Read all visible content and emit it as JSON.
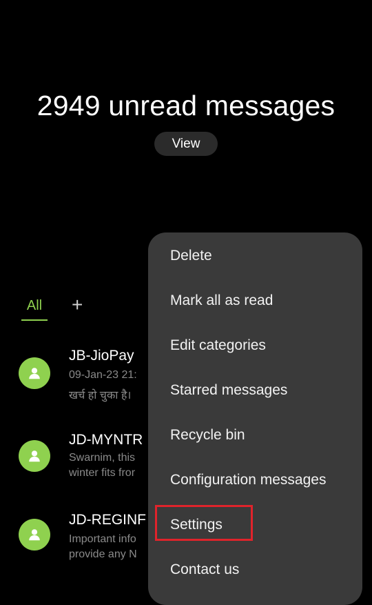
{
  "header": {
    "unread_count_text": "2949 unread messages",
    "view_button": "View"
  },
  "tabs": {
    "all_label": "All",
    "add_label": "+"
  },
  "conversations": [
    {
      "sender": "JB-JioPay",
      "line1": "09-Jan-23 21:",
      "line2": "खर्च हो चुका है। ",
      "avatar_icon": "person-icon"
    },
    {
      "sender": "JD-MYNTR",
      "line1": "Swarnim, this",
      "line2": "winter fits fror",
      "avatar_icon": "person-icon"
    },
    {
      "sender": "JD-REGINF",
      "line1": "Important info",
      "line2": "provide any N",
      "avatar_icon": "person-icon"
    }
  ],
  "menu": {
    "items": [
      "Delete",
      "Mark all as read",
      "Edit categories",
      "Starred messages",
      "Recycle bin",
      "Configuration messages",
      "Settings",
      "Contact us"
    ]
  },
  "colors": {
    "accent": "#8fd14f",
    "menu_bg": "#3a3a3a",
    "highlight": "#e0232b"
  }
}
